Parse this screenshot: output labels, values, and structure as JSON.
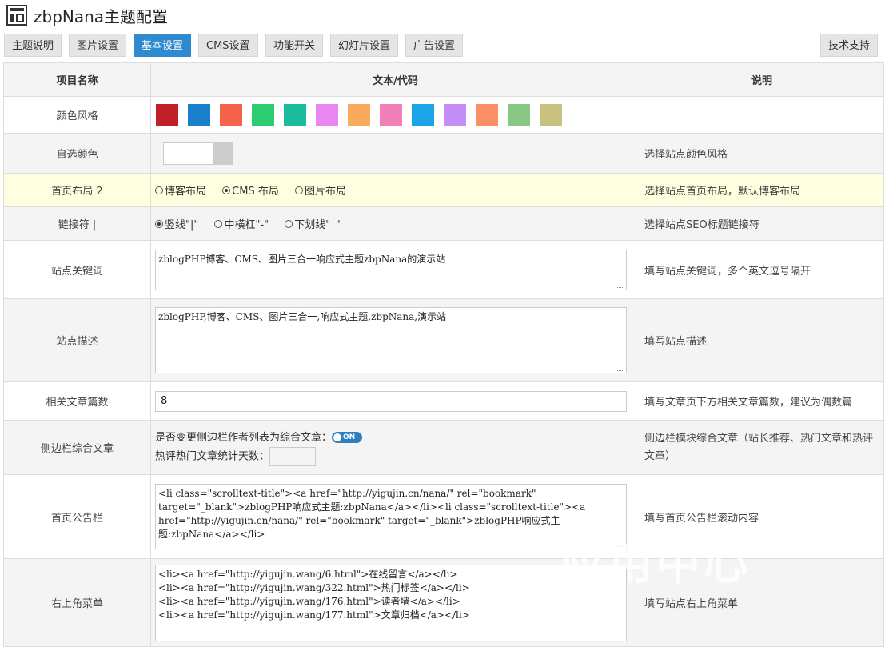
{
  "app": {
    "title": "zbpNana主题配置"
  },
  "tabs": [
    "主题说明",
    "图片设置",
    "基本设置",
    "CMS设置",
    "功能开关",
    "幻灯片设置",
    "广告设置"
  ],
  "support_tab": "技术支持",
  "active_tab": "基本设置",
  "headers": {
    "name": "项目名称",
    "value": "文本/代码",
    "desc": "说明"
  },
  "colors": [
    "#c0202a",
    "#1a7fc9",
    "#f5634a",
    "#2ecc71",
    "#1abc9c",
    "#e987f0",
    "#f9aa5b",
    "#f27fb6",
    "#1ba4e6",
    "#c38ef5",
    "#fc8f66",
    "#88c784",
    "#c8c281"
  ],
  "rows": {
    "color_style": {
      "label": "颜色风格"
    },
    "custom_color": {
      "label": "自选颜色",
      "desc": "选择站点颜色风格"
    },
    "home_layout": {
      "label": "首页布局 2",
      "options": [
        "博客布局",
        "CMS 布局",
        "图片布局"
      ],
      "selected": 1,
      "desc": "选择站点首页布局，默认博客布局"
    },
    "link_char": {
      "label": "链接符 |",
      "options": [
        "竖线\"|\"",
        "中横杠\"-\"",
        "下划线\"_\""
      ],
      "selected": 0,
      "desc": "选择站点SEO标题链接符"
    },
    "keywords": {
      "label": "站点关键词",
      "value": "zblogPHP博客、CMS、图片三合一响应式主题zbpNana的演示站",
      "desc": "填写站点关键词，多个英文逗号隔开"
    },
    "description": {
      "label": "站点描述",
      "value": "zblogPHP,博客、CMS、图片三合一,响应式主题,zbpNana,演示站",
      "desc": "填写站点描述"
    },
    "related": {
      "label": "相关文章篇数",
      "value": "8",
      "desc": "填写文章页下方相关文章篇数，建议为偶数篇"
    },
    "sidebar": {
      "label": "侧边栏综合文章",
      "line1": "是否变更侧边栏作者列表为综合文章：",
      "switch": "ON",
      "line2": "热评热门文章统计天数：",
      "desc": "侧边栏模块综合文章（站长推荐、热门文章和热评文章）"
    },
    "notice": {
      "label": "首页公告栏",
      "value": "<li class=\"scrolltext-title\"><a href=\"http://yigujin.cn/nana/\" rel=\"bookmark\" target=\"_blank\">zblogPHP响应式主题:zbpNana</a></li><li class=\"scrolltext-title\"><a href=\"http://yigujin.cn/nana/\" rel=\"bookmark\" target=\"_blank\">zblogPHP响应式主题:zbpNana</a></li>",
      "desc": "填写首页公告栏滚动内容"
    },
    "topmenu": {
      "label": "右上角菜单",
      "value": "<li><a href=\"http://yigujin.wang/6.html\">在线留言</a></li>\n<li><a href=\"http://yigujin.wang/322.html\">热门标签</a></li>\n<li><a href=\"http://yigujin.wang/176.html\">读者墙</a></li>\n<li><a href=\"http://yigujin.wang/177.html\">文章归档</a></li>",
      "desc": "填写站点右上角菜单"
    }
  },
  "watermark": "应用中心"
}
